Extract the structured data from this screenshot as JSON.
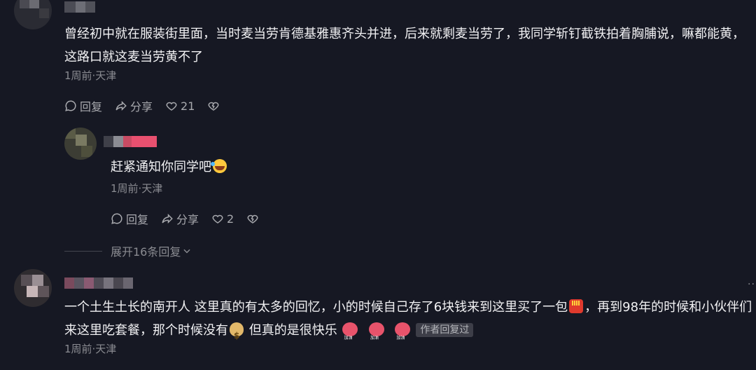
{
  "comments": [
    {
      "text": "曾经初中就在服装街里面，当时麦当劳肯德基雅惠齐头并进，后来就剩麦当劳了，我同学斩钉截铁拍着胸脯说，嘛都能黄，这路口就这麦当劳黄不了",
      "meta": "1周前·天津",
      "reply_label": "回复",
      "share_label": "分享",
      "like_count": "21"
    },
    {
      "text": "赶紧通知你同学吧",
      "emoji_icon": "rofl-emoji",
      "meta": "1周前·天津",
      "reply_label": "回复",
      "share_label": "分享",
      "like_count": "2"
    },
    {
      "text_part1": "一个土生土长的南开人 这里真的有太多的回忆，小的时候自己存了6块钱来到这里买了一包",
      "text_part2": "，再到98年的时候和小伙伴们来这里吃套餐，那个时候没有",
      "text_part3": "但真的是很快乐",
      "emoji_icons": [
        "fries-emoji",
        "money-bag-emoji",
        "cheer-emoji",
        "cheer-emoji",
        "cheer-emoji"
      ],
      "author_tag": "作者回复过",
      "meta": "1周前·天津"
    }
  ],
  "expand_replies": "展开16条回复",
  "colors": {
    "background": "#161823",
    "text": "#f1f1f3",
    "meta": "#8a8b91",
    "tag_bg": "#3d3e48"
  }
}
